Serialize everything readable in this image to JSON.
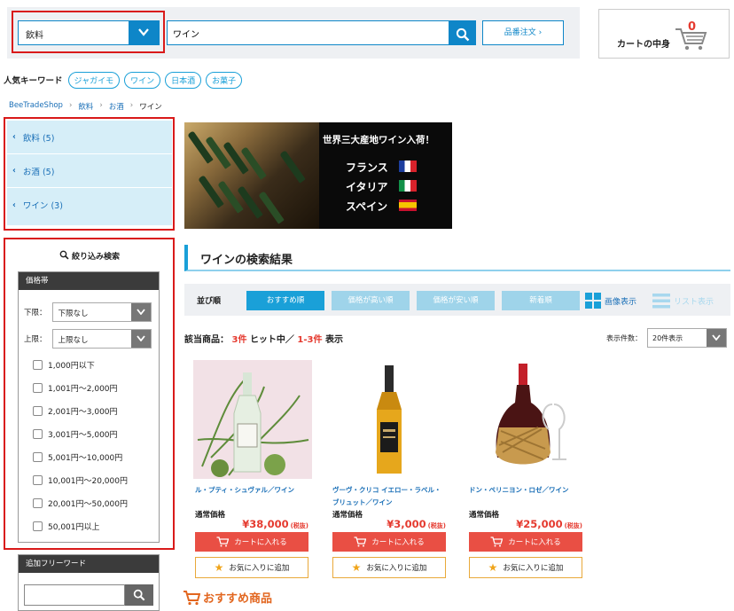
{
  "header": {
    "category_value": "飲料",
    "keyword_value": "ワイン",
    "order_by_code_label": "品番注文",
    "cart_label": "カートの中身",
    "cart_count": "0"
  },
  "popular": {
    "label": "人気キーワード",
    "keywords": [
      "ジャガイモ",
      "ワイン",
      "日本酒",
      "お菓子"
    ]
  },
  "breadcrumb": [
    "BeeTradeShop",
    "飲料",
    "お酒",
    "ワイン"
  ],
  "category_tree": [
    {
      "label": "飲料 (5)"
    },
    {
      "label": "お酒 (5)"
    },
    {
      "label": "ワイン (3)"
    }
  ],
  "refine": {
    "title": "絞り込み検索",
    "price_panel_title": "価格帯",
    "lower_label": "下限：",
    "lower_value": "下限なし",
    "upper_label": "上限：",
    "upper_value": "上限なし",
    "ranges": [
      "1,000円以下",
      "1,001円～2,000円",
      "2,001円～3,000円",
      "3,001円～5,000円",
      "5,001円～10,000円",
      "10,001円～20,000円",
      "20,001円～50,000円",
      "50,001円以上"
    ],
    "free_word_title": "追加フリーワード"
  },
  "banner": {
    "title": "世界三大産地ワイン入荷！",
    "countries": [
      "フランス",
      "イタリア",
      "スペイン"
    ]
  },
  "results": {
    "heading": "ワインの検索結果",
    "sort_label": "並び順",
    "sort_options": [
      "おすすめ順",
      "価格が高い順",
      "価格が安い順",
      "新着順"
    ],
    "view_image": "画像表示",
    "view_list": "リスト表示",
    "count_prefix": "該当商品：",
    "count_total": "3件",
    "count_mid": "ヒット中／",
    "count_range": "1-3件",
    "count_suffix": "表示",
    "per_page_label": "表示件数：",
    "per_page_value": "20件表示"
  },
  "products": [
    {
      "name": "ル・プティ・シュヴァル／ワイン",
      "price_label": "通常価格",
      "price": "¥38,000",
      "tax": "(税抜)",
      "cart_label": "カートに入れる",
      "fav_label": "お気に入りに追加"
    },
    {
      "name": "ヴーヴ・クリコ イエロー・ラベル・ブリュット／ワイン",
      "price_label": "通常価格",
      "price": "¥3,000",
      "tax": "(税抜)",
      "cart_label": "カートに入れる",
      "fav_label": "お気に入りに追加"
    },
    {
      "name": "ドン・ペリニヨン・ロゼ／ワイン",
      "price_label": "通常価格",
      "price": "¥25,000",
      "tax": "(税抜)",
      "cart_label": "カートに入れる",
      "fav_label": "お気に入りに追加"
    }
  ],
  "recommend_title": "おすすめ商品",
  "colors": {
    "accent": "#1aa0d8",
    "highlight": "#d91a1a",
    "price": "#e53a2f"
  }
}
